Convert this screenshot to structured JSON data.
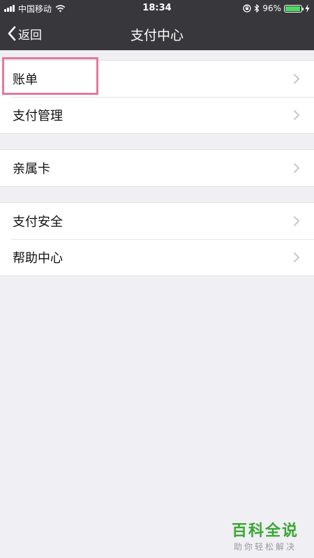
{
  "status_bar": {
    "carrier": "中国移动",
    "time": "18:34",
    "battery_percent": "96%",
    "battery_level": 0.96
  },
  "nav": {
    "back_label": "返回",
    "title": "支付中心"
  },
  "groups": [
    {
      "items": [
        {
          "label": "账单"
        },
        {
          "label": "支付管理"
        }
      ]
    },
    {
      "items": [
        {
          "label": "亲属卡"
        }
      ]
    },
    {
      "items": [
        {
          "label": "支付安全"
        },
        {
          "label": "帮助中心"
        }
      ]
    }
  ],
  "watermark": {
    "title": "百科全说",
    "subtitle": "助你轻松解决"
  },
  "colors": {
    "nav_background": "#38383c",
    "page_background": "#efeff4",
    "highlight_border": "#e07aa0",
    "watermark_green": "#3aa632"
  },
  "icons": [
    "cellular-signal-icon",
    "wifi-icon",
    "orientation-lock-icon",
    "bluetooth-icon",
    "battery-icon",
    "charging-icon",
    "chevron-left-icon",
    "chevron-right-icon"
  ]
}
